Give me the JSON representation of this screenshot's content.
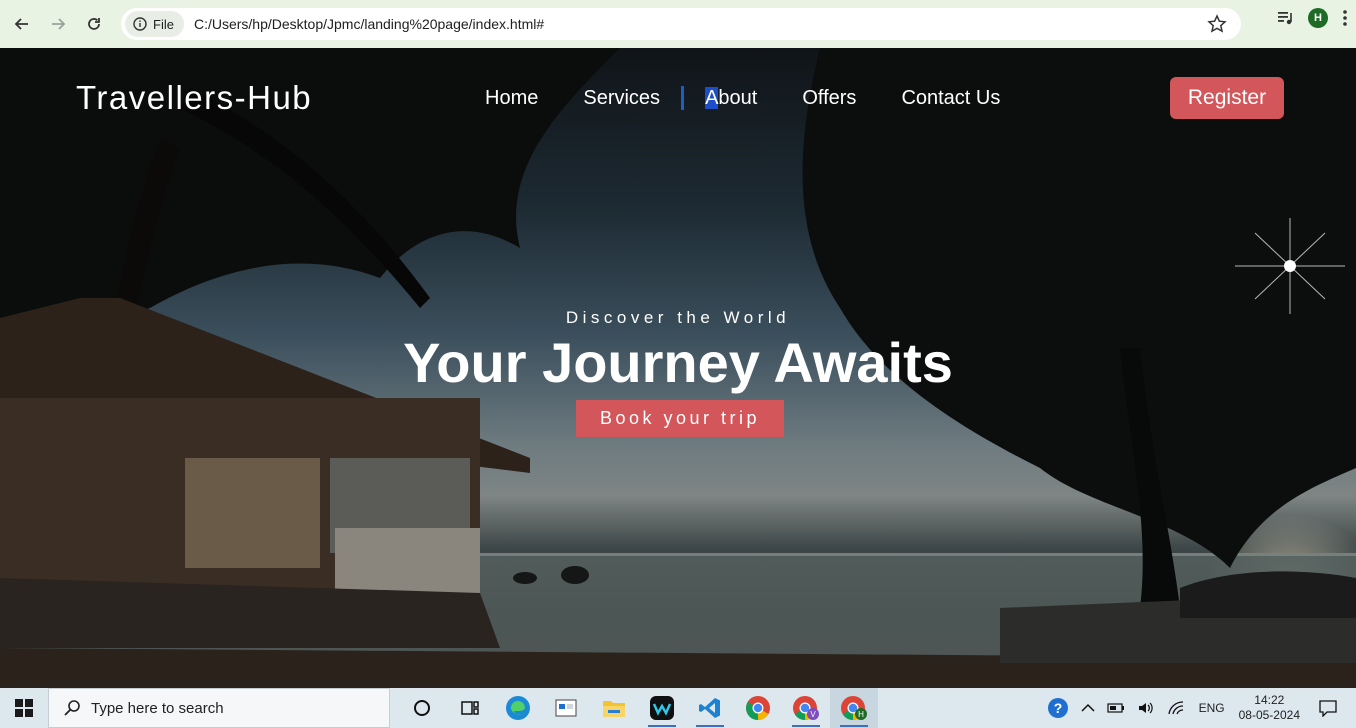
{
  "browser": {
    "site_chip": "File",
    "url": "C:/Users/hp/Desktop/Jpmc/landing%20page/index.html#",
    "profile_initial": "H",
    "icons": [
      "back-arrow-icon",
      "forward-arrow-icon",
      "reload-icon",
      "info-icon",
      "star-icon",
      "media-icon",
      "kebab-menu-icon"
    ]
  },
  "site": {
    "brand": "Travellers-Hub",
    "nav": {
      "home": "Home",
      "services": "Services",
      "about_first": "A",
      "about_rest": "bout",
      "offers": "Offers",
      "contact": "Contact Us"
    },
    "register": "Register",
    "kicker": "Discover the World",
    "headline": "Your Journey Awaits",
    "cta": "Book your trip",
    "colors": {
      "accent": "#d2565a",
      "nav_separator": "#1c5fc0",
      "selection": "#1d4ec9"
    }
  },
  "taskbar": {
    "search_placeholder": "Type here to search",
    "language": "ENG",
    "time": "14:22",
    "date": "08-05-2024",
    "apps": [
      "cortana-icon",
      "task-view-icon",
      "edge-icon",
      "store-icon",
      "file-explorer-icon",
      "webex-icon",
      "vscode-icon",
      "chrome-icon",
      "chrome-profile-v-icon",
      "chrome-profile-h-icon"
    ]
  }
}
